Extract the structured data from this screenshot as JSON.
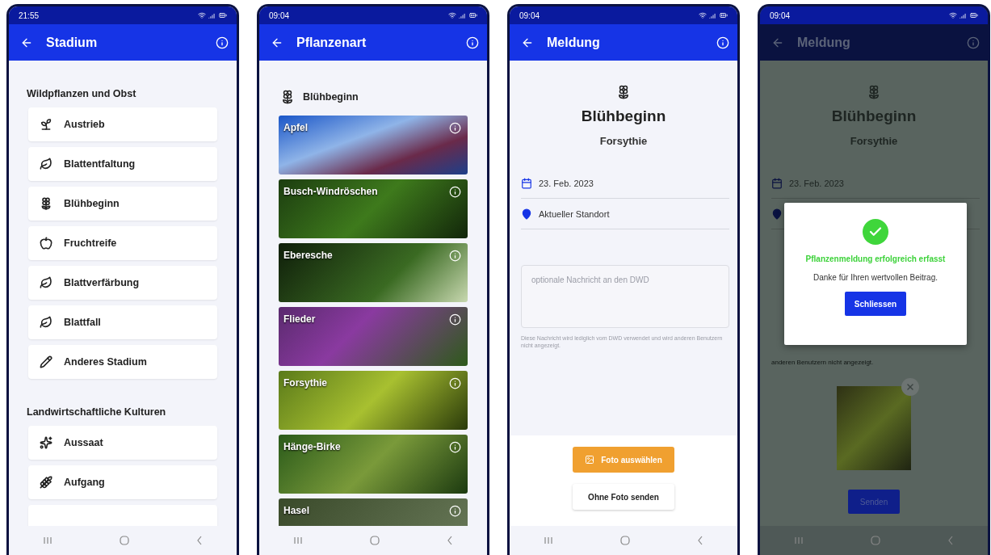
{
  "stage_screen": {
    "status_bar": {
      "time": "21:55"
    },
    "app_bar": {
      "title": "Stadium"
    },
    "sections": [
      {
        "title": "Wildpflanzen und Obst",
        "items": [
          "Austrieb",
          "Blattentfaltung",
          "Blühbeginn",
          "Fruchtreife",
          "Blattverfärbung",
          "Blattfall",
          "Anderes Stadium"
        ]
      },
      {
        "title": "Landwirtschaftliche Kulturen",
        "items": [
          "Aussaat",
          "Aufgang"
        ]
      }
    ]
  },
  "species_screen": {
    "status_bar": {
      "time": "09:04"
    },
    "app_bar": {
      "title": "Pflanzenart"
    },
    "stage": "Blühbeginn",
    "plants": [
      "Apfel",
      "Busch-Windröschen",
      "Eberesche",
      "Flieder",
      "Forsythie",
      "Hänge-Birke",
      "Hasel"
    ]
  },
  "report_screen": {
    "status_bar": {
      "time": "09:04"
    },
    "app_bar": {
      "title": "Meldung"
    },
    "stage": "Blühbeginn",
    "plant": "Forsythie",
    "date": "23. Feb. 2023",
    "location": "Aktueller Standort",
    "message": {
      "placeholder": "optionale Nachricht an den DWD"
    },
    "hint": "Diese Nachricht wird lediglich vom DWD verwendet und wird anderen Benutzern nicht angezeigt.",
    "buttons": [
      {
        "label": "Foto auswählen",
        "kind": "primary"
      },
      {
        "label": "Ohne Foto senden",
        "kind": "secondary"
      }
    ]
  },
  "success_screen": {
    "status_bar": {
      "time": "09:04"
    },
    "app_bar": {
      "title": "Meldung"
    },
    "stage": "Blühbeginn",
    "plant": "Forsythie",
    "date": "23. Feb. 2023",
    "hint_visible": "anderen Benutzern nicht angezeigt.",
    "send_button": "Senden",
    "dialog": {
      "title": "Pflanzenmeldung erfolgreich erfasst",
      "message": "Danke für Ihren wertvollen Beitrag.",
      "button": "Schliessen"
    }
  }
}
